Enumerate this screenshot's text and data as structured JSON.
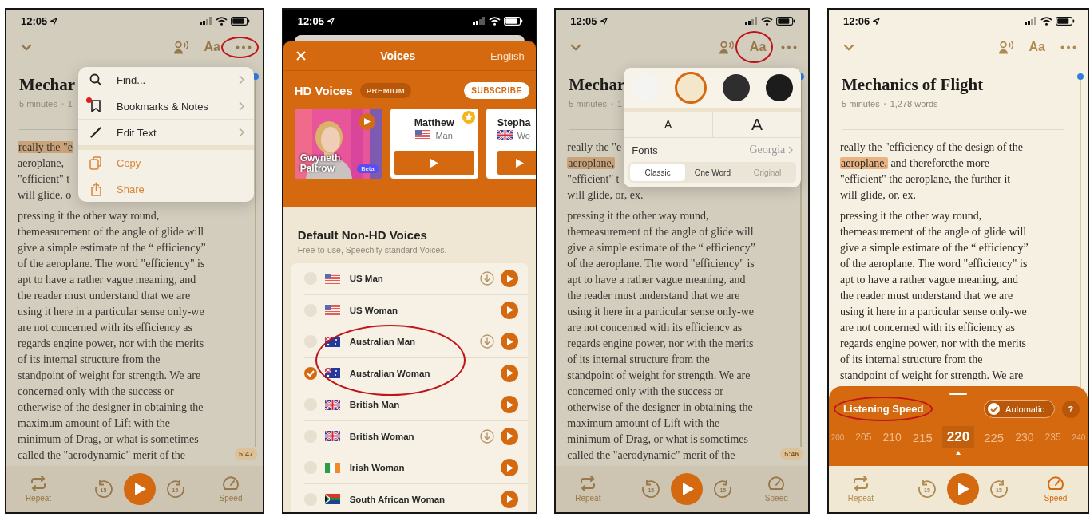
{
  "screens": [
    {
      "kind": "reader",
      "dimmed": true,
      "status_bar": {
        "time": "12:05"
      },
      "toolbar": [
        {
          "kind": "voice",
          "circled": false
        },
        {
          "kind": "font",
          "label": "Aa",
          "circled": false
        },
        {
          "kind": "more",
          "circled": true
        }
      ],
      "title": "Mechar",
      "meta": {
        "duration": "5 minutes",
        "words": "1"
      },
      "paragraphs": [
        [
          {
            "parts": [
              {
                "text": "really the \"e",
                "highlighted": true
              }
            ]
          },
          "aeroplane,",
          "\"efficient\" t",
          "will glide, o"
        ],
        [
          "pressing it the other way round,",
          "themeasurement of the angle of glide will",
          "give a simple estimate of the “ efficiency”",
          "of the aeroplane. The word \"efficiency\" is",
          "apt to have a rather vague meaning, and",
          "the reader must understand that we are",
          "using it here in a particular sense only-we",
          "are not concerned with its efficiency as",
          "regards engine power, nor with the merits",
          "of its internal structure from the",
          "standpoint of weight for strength. We are",
          "concerned only with the success or",
          "otherwise of the designer in obtaining the",
          "maximum amount of Lift with the",
          "minimum of Drag, or what is sometimes",
          "called the \"aerodynamic\" merit of the"
        ]
      ],
      "time_badge": "5:47",
      "player": {
        "repeat": "Repeat",
        "back": "15",
        "forward": "15",
        "speed": "Speed",
        "speed_active": false
      },
      "menu": [
        {
          "kind": "find",
          "label": "Find...",
          "badge": false,
          "submenu": true,
          "accent": false
        },
        {
          "kind": "bookmarks",
          "label": "Bookmarks & Notes",
          "badge": true,
          "submenu": true,
          "accent": false
        },
        {
          "kind": "edit",
          "label": "Edit Text",
          "badge": false,
          "submenu": true,
          "accent": false
        },
        {
          "kind": "copy",
          "label": "Copy",
          "badge": false,
          "submenu": false,
          "accent": true
        },
        {
          "kind": "share",
          "label": "Share",
          "badge": false,
          "submenu": false,
          "accent": true
        }
      ]
    },
    {
      "kind": "voices",
      "status_bar": {
        "time": "12:05"
      },
      "header": {
        "title": "Voices",
        "language": "English"
      },
      "hd": {
        "title": "HD Voices",
        "badge": "PREMIUM",
        "subscribe": "SUBSCRIBE"
      },
      "hd_cards": [
        {
          "kind": "picture",
          "name": "Gwyneth Paltrow",
          "tag": "Beta"
        },
        {
          "kind": "voice",
          "flag": {
            "kind": "us"
          },
          "name": "Matthew",
          "gender": "Man",
          "starred": true
        },
        {
          "kind": "voice",
          "flag": {
            "kind": "uk"
          },
          "name": "Stepha",
          "gender": "Wo",
          "starred": false
        }
      ],
      "section": {
        "title": "Default Non-HD Voices",
        "subtitle": "Free-to-use, Speechify standard Voices."
      },
      "voices": [
        {
          "kind": "us",
          "name": "US Man",
          "selected": false,
          "downloadable": true,
          "circled": false
        },
        {
          "kind": "us",
          "name": "US Woman",
          "selected": false,
          "downloadable": false,
          "circled": false
        },
        {
          "kind": "au",
          "name": "Australian Man",
          "selected": false,
          "downloadable": true,
          "circled": true
        },
        {
          "kind": "au",
          "name": "Australian Woman",
          "selected": true,
          "downloadable": false,
          "circled": true
        },
        {
          "kind": "uk",
          "name": "British Man",
          "selected": false,
          "downloadable": false,
          "circled": false
        },
        {
          "kind": "uk",
          "name": "British Woman",
          "selected": false,
          "downloadable": true,
          "circled": false
        },
        {
          "kind": "ie",
          "name": "Irish Woman",
          "selected": false,
          "downloadable": false,
          "circled": false
        },
        {
          "kind": "za",
          "name": "South African Woman",
          "selected": false,
          "downloadable": false,
          "circled": false
        }
      ]
    },
    {
      "kind": "reader",
      "dimmed": true,
      "status_bar": {
        "time": "12:05"
      },
      "toolbar": [
        {
          "kind": "voice",
          "circled": false
        },
        {
          "kind": "font",
          "label": "Aa",
          "circled": true
        },
        {
          "kind": "more",
          "circled": false
        }
      ],
      "title": "Mechar",
      "meta": {
        "duration": "5 minutes",
        "words": "1"
      },
      "paragraphs": [
        [
          "really the \"e",
          {
            "parts": [
              {
                "text": "aeroplane,",
                "highlighted": true
              }
            ]
          },
          "\"efficient\" t",
          "will glide, or, ex."
        ],
        [
          "pressing it the other way round,",
          "themeasurement of the angle of glide will",
          "give a simple estimate of the “ efficiency”",
          "of the aeroplane. The word \"efficiency\" is",
          "apt to have a rather vague meaning, and",
          "the reader must understand that we are",
          "using it here in a particular sense only-we",
          "are not concerned with its efficiency as",
          "regards engine power, nor with the merits",
          "of its internal structure from the",
          "standpoint of weight for strength. We are",
          "concerned only with the success or",
          "otherwise of the designer in obtaining the",
          "maximum amount of Lift with the",
          "minimum of Drag, or what is sometimes",
          "called the \"aerodynamic\" merit of the"
        ]
      ],
      "time_badge": "5:46",
      "player": {
        "repeat": "Repeat",
        "back": "15",
        "forward": "15",
        "speed": "Speed",
        "speed_active": false
      },
      "appearance": {
        "themes": [
          {
            "color": "#f4f4f2",
            "selected": false
          },
          {
            "color": "#f3e6c9",
            "selected": true
          },
          {
            "color": "#2e2e2e",
            "selected": false
          },
          {
            "color": "#1c1c1c",
            "selected": false
          }
        ],
        "sizes": [
          {
            "kind": "smaller",
            "label": "A"
          },
          {
            "kind": "larger",
            "label": "A"
          }
        ],
        "fonts": {
          "label": "Fonts",
          "value": "Georgia"
        },
        "modes": [
          {
            "label": "Classic",
            "selected": true,
            "disabled": false
          },
          {
            "label": "One Word",
            "selected": false,
            "disabled": false
          },
          {
            "label": "Original",
            "selected": false,
            "disabled": true
          }
        ]
      }
    },
    {
      "kind": "reader",
      "dimmed": false,
      "status_bar": {
        "time": "12:06"
      },
      "toolbar": [
        {
          "kind": "voice",
          "circled": false
        },
        {
          "kind": "font",
          "label": "Aa",
          "circled": false
        },
        {
          "kind": "more",
          "circled": false
        }
      ],
      "title": "Mechanics of Flight",
      "meta": {
        "duration": "5 minutes",
        "words": "1,278 words"
      },
      "paragraphs": [
        [
          "really the \"efficiency of the design of the",
          {
            "parts": [
              {
                "text": "aeroplane,",
                "highlighted": true
              },
              {
                "text": " and thereforethe more",
                "highlighted": false
              }
            ]
          },
          "\"efficient\" the aeroplane, the further it",
          "will glide, or, ex."
        ],
        [
          "pressing it the other way round,",
          "themeasurement of the angle of glide will",
          "give a simple estimate of the “ efficiency”",
          "of the aeroplane. The word \"efficiency\" is",
          "apt to have a rather vague meaning, and",
          "the reader must understand that we are",
          "using it here in a particular sense only-we",
          "are not concerned with its efficiency as",
          "regards engine power, nor with the merits",
          "of its internal structure from the",
          "standpoint of weight for strength. We are"
        ]
      ],
      "player": {
        "repeat": "Repeat",
        "back": "15",
        "forward": "15",
        "speed": "Speed",
        "speed_active": true
      },
      "speed_sheet": {
        "title": "Listening Speed",
        "circled": true,
        "automatic": {
          "label": "Automatic",
          "checked": true
        },
        "help": "?",
        "speeds": [
          {
            "label": "200",
            "selected": false
          },
          {
            "label": "205",
            "selected": false
          },
          {
            "label": "210",
            "selected": false
          },
          {
            "label": "215",
            "selected": false
          },
          {
            "label": "220",
            "selected": true
          },
          {
            "label": "225",
            "selected": false
          },
          {
            "label": "230",
            "selected": false
          },
          {
            "label": "235",
            "selected": false
          },
          {
            "label": "240",
            "selected": false
          }
        ]
      }
    }
  ]
}
